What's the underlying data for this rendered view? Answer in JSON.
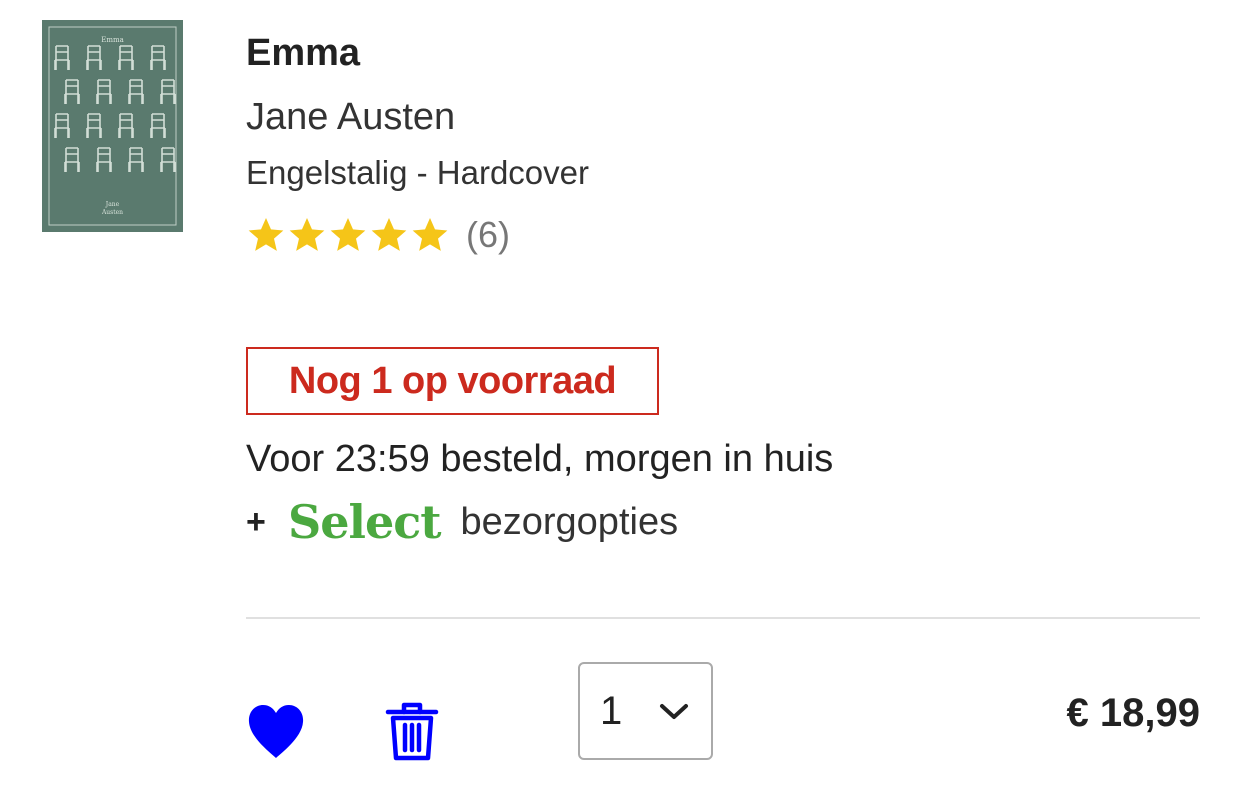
{
  "product": {
    "title": "Emma",
    "author": "Jane Austen",
    "format": "Engelstalig - Hardcover",
    "cover": {
      "icon": "book-cover-image",
      "background_color": "#5a7a6e",
      "pattern_color": "#d9e4dc",
      "cover_title": "Emma",
      "cover_author_line1": "Jane",
      "cover_author_line2": "Austen"
    },
    "rating": {
      "stars": 5,
      "max_stars": 5,
      "count_label": "(6)",
      "star_color": "#f5c518"
    }
  },
  "availability": {
    "stock_label": "Nog 1 op voorraad",
    "stock_color": "#cc2a1e",
    "delivery_text": "Voor 23:59 besteld, morgen in huis",
    "plus_symbol": "+",
    "select_brand": "Select",
    "select_brand_color": "#4ba840",
    "select_suffix": "bezorgopties"
  },
  "actions": {
    "wishlist_icon": "heart-icon",
    "delete_icon": "trash-icon",
    "icon_color": "#0000ff",
    "quantity": {
      "selected": "1",
      "chevron_icon": "chevron-down-icon"
    },
    "price": "€ 18,99"
  }
}
